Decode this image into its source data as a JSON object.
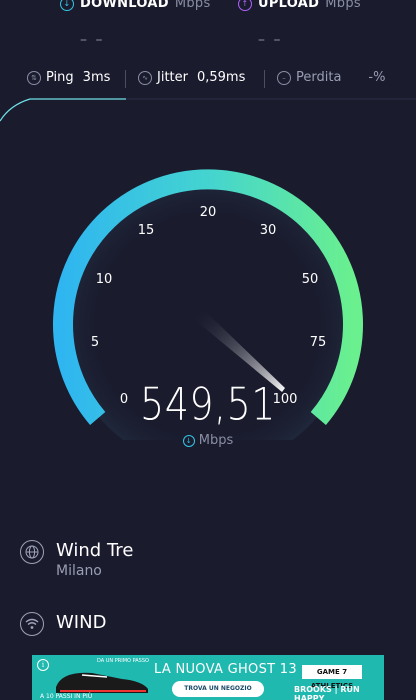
{
  "header": {
    "download": {
      "label": "DOWNLOAD",
      "unit": "Mbps",
      "value": "– –",
      "icon": "arrow-down-circle-icon",
      "color": "#33c7e6"
    },
    "upload": {
      "label": "UPLOAD",
      "unit": "Mbps",
      "value": "– –",
      "icon": "arrow-up-circle-icon",
      "color": "#b061ff"
    }
  },
  "stats": {
    "ping": {
      "label": "Ping",
      "value": "3ms"
    },
    "jitter": {
      "label": "Jitter",
      "value": "0,59ms"
    },
    "loss": {
      "label": "Perdita",
      "value": "-%"
    }
  },
  "gauge": {
    "ticks": [
      "0",
      "5",
      "10",
      "15",
      "20",
      "30",
      "50",
      "75",
      "100"
    ],
    "needle_value_mbps": 549.51,
    "colors": {
      "start": "#2fb6f0",
      "end": "#6af08e"
    }
  },
  "speed": {
    "value": "549,51",
    "unit": "Mbps"
  },
  "provider": {
    "name": "Wind Tre",
    "location": "Milano",
    "icon": "globe-icon"
  },
  "network": {
    "name": "WIND",
    "icon": "wifi-icon"
  },
  "ad": {
    "headline": "LA NUOVA GHOST 13",
    "cta": "TROVA UN NEGOZIO",
    "brand_top": "GAME 7 ATHLETICS",
    "brand_bottom": "BROOKS | RUN HAPPY",
    "small_text": "DA UN PRIMO PASSO",
    "bottom_text": "A 10 PASSI IN PIÙ"
  }
}
